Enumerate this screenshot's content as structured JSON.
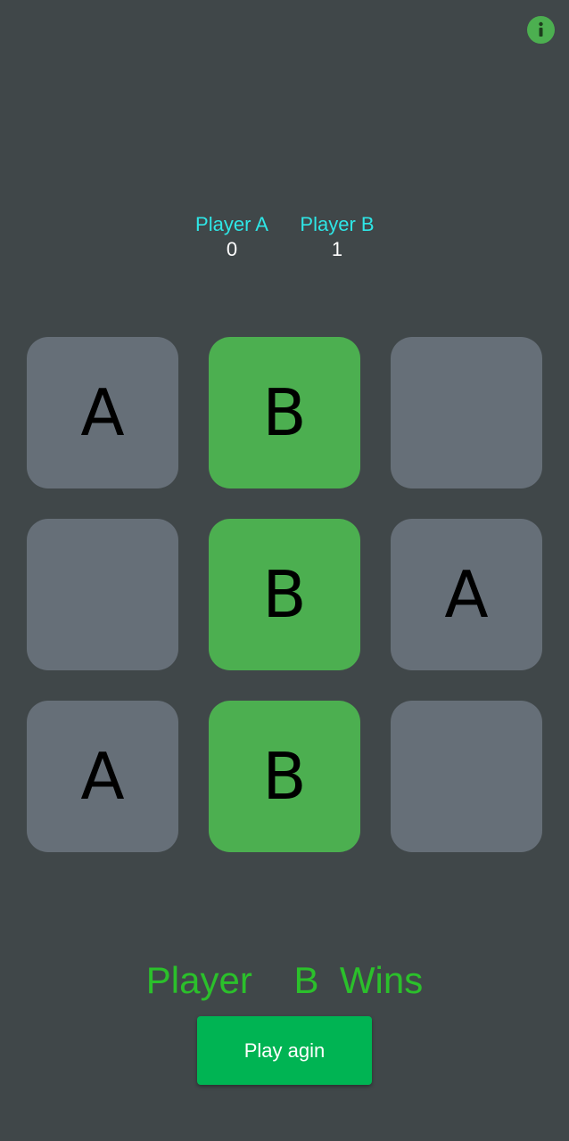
{
  "scoreboard": {
    "player_a": {
      "label": "Player A",
      "score": "0"
    },
    "player_b": {
      "label": "Player B",
      "score": "1"
    }
  },
  "board": {
    "cells": [
      {
        "mark": "A",
        "highlight": false
      },
      {
        "mark": "B",
        "highlight": true
      },
      {
        "mark": "",
        "highlight": false
      },
      {
        "mark": "",
        "highlight": false
      },
      {
        "mark": "B",
        "highlight": true
      },
      {
        "mark": "A",
        "highlight": false
      },
      {
        "mark": "A",
        "highlight": false
      },
      {
        "mark": "B",
        "highlight": true
      },
      {
        "mark": "",
        "highlight": false
      }
    ]
  },
  "result": {
    "text": "Player    B  Wins"
  },
  "actions": {
    "play_again_label": "Play agin"
  },
  "icons": {
    "info": "info-icon"
  },
  "colors": {
    "background": "#404749",
    "cell": "#666f78",
    "cell_highlight": "#4caf50",
    "player_label": "#2ee6e6",
    "result_text": "#2bc02b",
    "button": "#00b453"
  }
}
